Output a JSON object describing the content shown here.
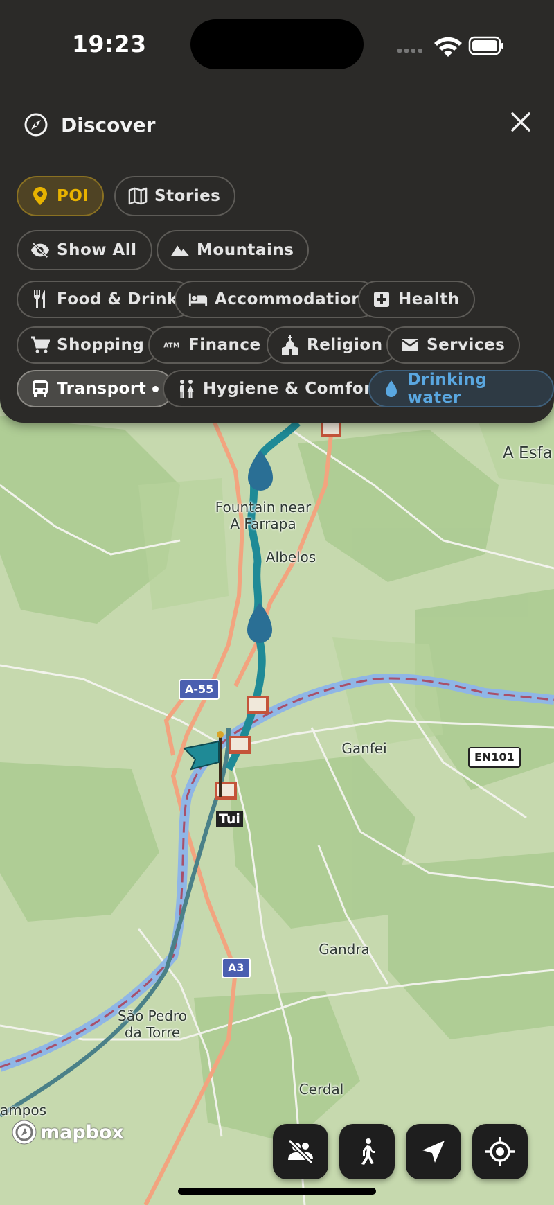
{
  "status_bar": {
    "time": "19:23"
  },
  "panel": {
    "title": "Discover",
    "chips": {
      "poi": "POI",
      "stories": "Stories",
      "show_all": "Show All",
      "mountains": "Mountains",
      "food": "Food & Drink",
      "accommodation": "Accommodation",
      "health": "Health",
      "shopping": "Shopping",
      "finance": "Finance",
      "religion": "Religion",
      "services": "Services",
      "transport": "Transport",
      "hygiene": "Hygiene & Comfort",
      "water": "Drinking water"
    },
    "colors": {
      "active_poi": "#e7b200",
      "active_water": "#5aa7e0",
      "background": "#2b2a28"
    }
  },
  "map": {
    "labels": {
      "fountain": "Fountain near\nA Farrapa",
      "albelos": "Albelos",
      "a_esfa": "A Esfa",
      "ganfei": "Ganfei",
      "gandra": "Gandra",
      "sao_pedro": "São Pedro\nda Torre",
      "cerdal": "Cerdal",
      "campos": "ampos",
      "tui": "Tui"
    },
    "road_shields": {
      "a55": "A-55",
      "en101": "EN101",
      "a3": "A3"
    },
    "attribution": "mapbox"
  },
  "icons": {
    "header": "compass-icon",
    "close": "close-icon",
    "fabs": [
      "hide-people-icon",
      "walk-icon",
      "navigate-arrow-icon",
      "locate-icon"
    ]
  }
}
